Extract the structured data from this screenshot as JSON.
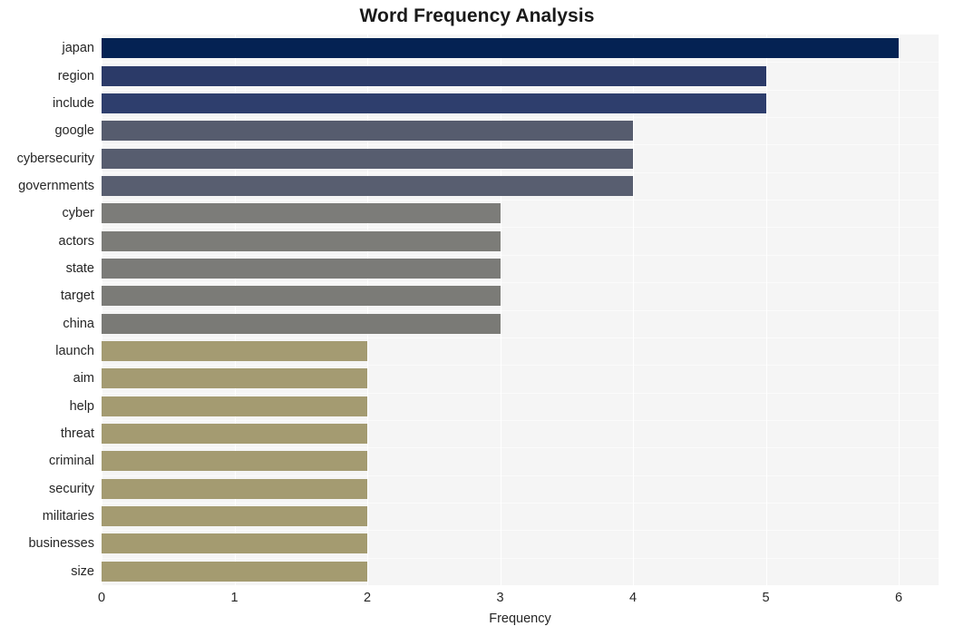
{
  "chart_data": {
    "type": "bar",
    "orientation": "horizontal",
    "title": "Word Frequency Analysis",
    "xlabel": "Frequency",
    "ylabel": "",
    "xlim": [
      0,
      6.3
    ],
    "xticks": [
      "0",
      "1",
      "2",
      "3",
      "4",
      "5",
      "6"
    ],
    "xtick_values": [
      0,
      1,
      2,
      3,
      4,
      5,
      6
    ],
    "grid": true,
    "legend": "none",
    "categories": [
      "japan",
      "region",
      "include",
      "google",
      "cybersecurity",
      "governments",
      "cyber",
      "actors",
      "state",
      "target",
      "china",
      "launch",
      "aim",
      "help",
      "threat",
      "criminal",
      "security",
      "militaries",
      "businesses",
      "size"
    ],
    "values": [
      6,
      5,
      5,
      4,
      4,
      4,
      3,
      3,
      3,
      3,
      3,
      2,
      2,
      2,
      2,
      2,
      2,
      2,
      2,
      2
    ],
    "bar_colors": [
      "#042253",
      "#2b3a68",
      "#2e3e6d",
      "#565c6e",
      "#575d6f",
      "#585e70",
      "#7c7c79",
      "#7c7c78",
      "#7b7b78",
      "#7b7b77",
      "#7a7a76",
      "#a49b72",
      "#a49b72",
      "#a49b71",
      "#a49b71",
      "#a49b71",
      "#a49b71",
      "#a49b71",
      "#a49b70",
      "#a49b70"
    ]
  },
  "style": {
    "plot_background": "#f5f5f5",
    "grid_color": "#ffffff",
    "figure_background": "#ffffff",
    "text_color": "#262626",
    "title_color": "#1a1a1a"
  }
}
